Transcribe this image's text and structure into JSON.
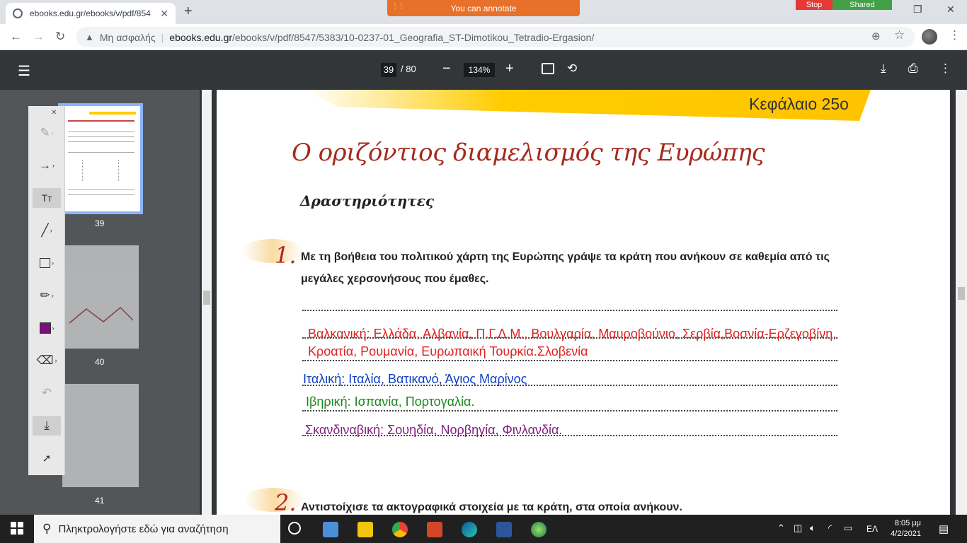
{
  "browser": {
    "tab_title": "ebooks.edu.gr/ebooks/v/pdf/854",
    "tab_close": "✕",
    "new_tab": "+",
    "annotate_bar": "You can annotate",
    "stop_label": "Stop",
    "shared_label": "Shared",
    "security_label": "Μη ασφαλής",
    "url_host": "ebooks.edu.gr",
    "url_path": "/ebooks/v/pdf/8547/5383/10-0237-01_Geografia_ST-Dimotikou_Tetradio-Ergasion/"
  },
  "pdf_toolbar": {
    "current_page": "39",
    "total_pages": "/ 80",
    "zoom": "134%"
  },
  "thumbnails": [
    {
      "label": "39",
      "selected": true
    },
    {
      "label": "40",
      "selected": false
    },
    {
      "label": "41",
      "selected": false
    }
  ],
  "tools": {
    "close": "✕",
    "text_tool": "Tт",
    "swatch_color": "#7b0f7b"
  },
  "page": {
    "chapter": "Κεφάλαιο 25ο",
    "title": "Ο οριζόντιος διαμελισμός της Ευρώπης",
    "subtitle": "Δραστηριότητες",
    "q1_num": "1.",
    "q1_text": "Με τη βοήθεια του πολιτικού χάρτη της Ευρώπης γράψε τα κράτη που ανήκουν σε καθεμία από τις μεγάλες χερσονήσους που έμαθες.",
    "ans_balkan": "Βαλκανική: Ελλάδα, Αλβανία, Π.Γ.Δ.Μ., Βουλγαρία, Μαυροβούνιο, Σερβία,Βοσνία-Ερζεγοβίνη, Κροατία, Ρουμανία, Ευρωπαική Τουρκία.Σλοβενία",
    "ans_italy": "Ιταλική: Ιταλία, Βατικανό, Άγιος Μαρίνος",
    "ans_iberian_label": "Ιβηρική: Ισπανία,",
    "ans_iberian_rest": "Πορτογαλία.",
    "ans_scand": "Σκανδιναβική: Σουηδία, Νορβηγία, Φινλανδία.",
    "q2_num": "2.",
    "q2_text": "Αντιστοίχισε τα ακτογραφικά στοιχεία με τα κράτη, στα οποία ανήκουν."
  },
  "taskbar": {
    "search_placeholder": "Πληκτρολογήστε εδώ για αναζήτηση",
    "lang": "ΕΛ",
    "time": "8:05 μμ",
    "date": "4/2/2021"
  }
}
